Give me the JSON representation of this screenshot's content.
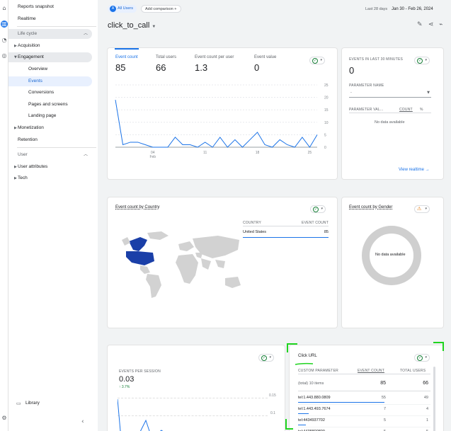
{
  "nav": {
    "reports_snapshot": "Reports snapshot",
    "realtime": "Realtime",
    "life_cycle": "Life cycle",
    "acquisition": "Acquisition",
    "engagement": "Engagement",
    "overview": "Overview",
    "events": "Events",
    "conversions": "Conversions",
    "pages_and_screens": "Pages and screens",
    "landing_page": "Landing page",
    "monetization": "Monetization",
    "retention": "Retention",
    "user": "User",
    "user_attributes": "User attributes",
    "tech": "Tech",
    "library": "Library"
  },
  "header": {
    "segment_letter": "A",
    "segment": "All Users",
    "add_comparison": "Add comparison",
    "date_label": "Last 28 days",
    "date_range": "Jan 30 - Feb 26, 2024",
    "title": "click_to_call"
  },
  "metrics": [
    {
      "label": "Event count",
      "value": "85"
    },
    {
      "label": "Total users",
      "value": "66"
    },
    {
      "label": "Event count per user",
      "value": "1.3"
    },
    {
      "label": "Event value",
      "value": "0"
    }
  ],
  "chart_data": {
    "type": "line",
    "x": [
      1,
      2,
      3,
      4,
      5,
      6,
      7,
      8,
      9,
      10,
      11,
      12,
      13,
      14,
      15,
      16,
      17,
      18,
      19,
      20,
      21,
      22,
      23,
      24,
      25,
      26,
      27,
      28
    ],
    "values": [
      19,
      1,
      2,
      2,
      1,
      0,
      0,
      0,
      4,
      1,
      1,
      0,
      2,
      0,
      4,
      0,
      3,
      0,
      3,
      6,
      1,
      0,
      3,
      1,
      0,
      4,
      0,
      5
    ],
    "yticks": [
      "25",
      "20",
      "15",
      "10",
      "5",
      "0"
    ],
    "ylim": [
      0,
      25
    ],
    "xticks": [
      {
        "label": "04",
        "sub": "Feb",
        "x": 6
      },
      {
        "label": "11",
        "sub": "",
        "x": 13
      },
      {
        "label": "18",
        "sub": "",
        "x": 20
      },
      {
        "label": "25",
        "sub": "",
        "x": 27
      }
    ],
    "color": "#1a73e8"
  },
  "realtime": {
    "title": "EVENTS IN LAST 30 MINUTES",
    "value": "0",
    "param_label": "PARAMETER NAME",
    "param_value": "-",
    "col1": "PARAMETER VAL...",
    "col2": "COUNT",
    "col3": "%",
    "empty": "No data available",
    "link": "View realtime"
  },
  "country": {
    "title": "Event count by Country",
    "col1": "COUNTRY",
    "col2": "EVENT COUNT",
    "row_country": "United States",
    "row_value": "85"
  },
  "gender": {
    "title": "Event count by Gender",
    "empty": "No data available"
  },
  "sessions": {
    "label": "EVENTS PER SESSION",
    "value": "0.03",
    "change": "3.7%",
    "y1": "0.15",
    "y2": "0.1"
  },
  "clickurl": {
    "title": "Click URL",
    "col1": "CUSTOM PARAMETER",
    "col2": "EVENT COUNT",
    "col3": "TOTAL USERS",
    "total_label": "(total) 10 items",
    "total_events": "85",
    "total_users": "66",
    "rows": [
      {
        "param": "tel:1.443.880.0809",
        "events": "55",
        "users": "49",
        "share": 0.65
      },
      {
        "param": "tel:1.443.493.7674",
        "events": "7",
        "users": "4",
        "share": 0.08
      },
      {
        "param": "tel:4434937702",
        "events": "5",
        "users": "1",
        "share": 0.06
      },
      {
        "param": "tel:4438800809",
        "events": "5",
        "users": "5",
        "share": 0.06
      }
    ]
  }
}
